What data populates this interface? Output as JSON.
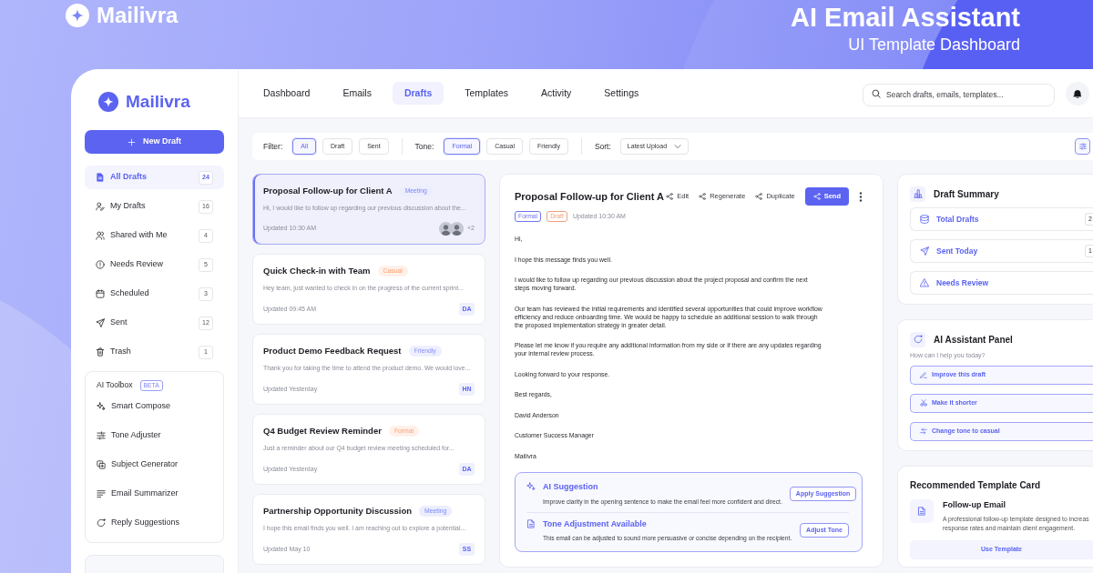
{
  "banner": {
    "brand": "Mailivra",
    "title": "AI Email Assistant",
    "subtitle": "UI Template Dashboard"
  },
  "sidebar": {
    "brand": "Mailivra",
    "new_button": "New Draft",
    "items": [
      {
        "label": "All Drafts",
        "count": "24",
        "selected": true
      },
      {
        "label": "My Drafts",
        "count": "16",
        "selected": false
      },
      {
        "label": "Shared with Me",
        "count": "4",
        "selected": false
      },
      {
        "label": "Needs Review",
        "count": "5",
        "selected": false
      },
      {
        "label": "Scheduled",
        "count": "3",
        "selected": false
      },
      {
        "label": "Sent",
        "count": "12",
        "selected": false
      },
      {
        "label": "Trash",
        "count": "1",
        "selected": false
      }
    ],
    "toolbox": {
      "title": "AI Toolbox",
      "badge": "BETA",
      "items": [
        "Smart Compose",
        "Tone Adjuster",
        "Subject Generator",
        "Email Summarizer",
        "Reply Suggestions"
      ]
    }
  },
  "nav": {
    "tabs": [
      {
        "label": "Dashboard",
        "selected": false
      },
      {
        "label": "Emails",
        "selected": false
      },
      {
        "label": "Drafts",
        "selected": true
      },
      {
        "label": "Templates",
        "selected": false
      },
      {
        "label": "Activity",
        "selected": false
      },
      {
        "label": "Settings",
        "selected": false
      }
    ],
    "search": {
      "placeholder": "Search drafts, emails, templates..."
    }
  },
  "filter_bar": {
    "groups": [
      {
        "label": "Filter:",
        "options": [
          {
            "label": "All",
            "selected": true
          },
          {
            "label": "Draft",
            "selected": false
          },
          {
            "label": "Sent",
            "selected": false
          }
        ]
      },
      {
        "label": "Tone:",
        "options": [
          {
            "label": "Formal",
            "selected": true
          },
          {
            "label": "Casual",
            "selected": false
          },
          {
            "label": "Friendly",
            "selected": false
          }
        ]
      }
    ],
    "sort": {
      "label": "Sort:",
      "value": "Latest Upload"
    }
  },
  "drafts": [
    {
      "title": "Proposal Follow-up for Client A",
      "tag": {
        "label": "Meeting",
        "color": "#eceefe"
      },
      "preview": "Hi, I would like to follow up regarding our previous discussion about the...",
      "updated": "Updated 10:30 AM",
      "selected": true,
      "assignee": {
        "kind": "avatars",
        "more": "+2"
      }
    },
    {
      "title": "Quick Check-in with Team",
      "tag": {
        "label": "Casual",
        "color": "#fff1ea"
      },
      "preview": "Hey team, just wanted to check in on the progress of the current sprint...",
      "updated": "Updated 09:45 AM",
      "selected": false,
      "assignee": {
        "kind": "initials",
        "label": "DA"
      }
    },
    {
      "title": "Product Demo Feedback Request",
      "tag": {
        "label": "Friendly",
        "color": "#eeeffe"
      },
      "preview": "Thank you for taking the time to attend the product demo. We would love...",
      "updated": "Updated Yesterday",
      "selected": false,
      "assignee": {
        "kind": "initials",
        "label": "HN"
      }
    },
    {
      "title": "Q4 Budget Review Reminder",
      "tag": {
        "label": "Formal",
        "color": "#fff1ea"
      },
      "preview": "Just a reminder about our Q4 budget review meeting scheduled for...",
      "updated": "Updated Yesterday",
      "selected": false,
      "assignee": {
        "kind": "initials",
        "label": "DA"
      }
    },
    {
      "title": "Partnership Opportunity Discussion",
      "tag": {
        "label": "Meeting",
        "color": "#eceefe"
      },
      "preview": "I hope this email finds you well. I am reaching out to explore a potential...",
      "updated": "Updated May 10",
      "selected": false,
      "assignee": {
        "kind": "initials",
        "label": "SS"
      }
    }
  ],
  "email": {
    "title": "Proposal Follow-up for Client A",
    "actions": [
      {
        "label": "Edit",
        "kind": "link"
      },
      {
        "label": "Regenerate",
        "kind": "link"
      },
      {
        "label": "Duplicate",
        "kind": "link"
      },
      {
        "label": "Send",
        "kind": "primary"
      }
    ],
    "tags": [
      {
        "label": "Formal",
        "color": "#6e75f0"
      },
      {
        "label": "Draft",
        "color": "#f3a07c"
      }
    ],
    "updated": "Updated 10:30 AM",
    "body": [
      "Hi,",
      "I hope this message finds you well.",
      "I would like to follow up regarding our previous discussion about the project proposal and confirm the next steps moving forward.",
      "Our team has reviewed the initial requirements and identified several opportunities that could improve workflow efficiency and reduce onboarding time. We would be happy to schedule an additional session to walk through the proposed implementation strategy in greater detail.",
      "Please let me know if you require any additional information from my side or if there are any updates regarding your internal review process.",
      "Looking forward to your response.",
      "Best regards,",
      "David Anderson",
      "Customer Success Manager",
      "Mailivra"
    ],
    "suggestions": [
      {
        "title": "AI Suggestion",
        "text": "Improve clarity in the opening sentence to make the email feel more confident and direct.",
        "button": "Apply Suggestion"
      },
      {
        "title": "Tone Adjustment Available",
        "text": "This email can be adjusted to sound more persuasive or concise depending on the recipient.",
        "button": "Adjust Tone"
      }
    ]
  },
  "summary": {
    "title": "Draft Summary",
    "stats": [
      {
        "label": "Total Drafts",
        "count": "2"
      },
      {
        "label": "Sent Today",
        "count": "1"
      },
      {
        "label": "Needs Review"
      }
    ]
  },
  "assistant": {
    "title": "AI Assistant Panel",
    "prompt": "How can I help you today?",
    "actions": [
      "Improve this draft",
      "Make it shorter",
      "Change tone to casual"
    ]
  },
  "template": {
    "heading": "Recommended Template Card",
    "name": "Follow-up Email",
    "description_lines": [
      "A professional follow-up template designed to increas",
      "response rates and maintain client engagement."
    ],
    "button": "Use Template"
  }
}
